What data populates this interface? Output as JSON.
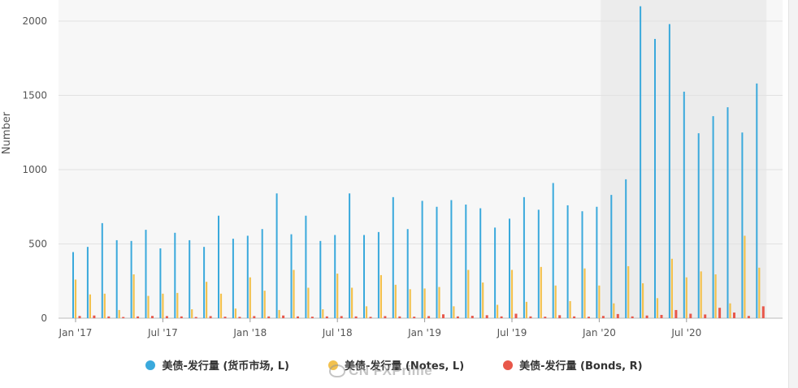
{
  "chart_data": {
    "type": "bar",
    "title": "",
    "xlabel": "",
    "ylabel": "Number",
    "ylim": [
      0,
      2000
    ],
    "y_ticks": [
      "0",
      "500",
      "1000",
      "1500",
      "2000"
    ],
    "x_tick_labels": [
      "Jan '17",
      "Jul '17",
      "Jan '18",
      "Jul '18",
      "Jan '19",
      "Jul '19",
      "Jan '20",
      "Jul '20"
    ],
    "x_tick_month_index": [
      0,
      6,
      12,
      18,
      24,
      30,
      36,
      42
    ],
    "grid": true,
    "legend_position": "bottom",
    "highlight_region": {
      "from_month_index": 37,
      "to_month_index": 47
    },
    "categories": [
      "2017-01",
      "2017-02",
      "2017-03",
      "2017-04",
      "2017-05",
      "2017-06",
      "2017-07",
      "2017-08",
      "2017-09",
      "2017-10",
      "2017-11",
      "2017-12",
      "2018-01",
      "2018-02",
      "2018-03",
      "2018-04",
      "2018-05",
      "2018-06",
      "2018-07",
      "2018-08",
      "2018-09",
      "2018-10",
      "2018-11",
      "2018-12",
      "2019-01",
      "2019-02",
      "2019-03",
      "2019-04",
      "2019-05",
      "2019-06",
      "2019-07",
      "2019-08",
      "2019-09",
      "2019-10",
      "2019-11",
      "2019-12",
      "2020-01",
      "2020-02",
      "2020-03",
      "2020-04",
      "2020-05",
      "2020-06",
      "2020-07",
      "2020-08",
      "2020-09",
      "2020-10",
      "2020-11",
      "2020-12"
    ],
    "series": [
      {
        "name": "美债-发行量 (货币市场, L)",
        "color": "#3aa9dc",
        "values": [
          445,
          480,
          640,
          525,
          520,
          595,
          470,
          575,
          525,
          480,
          690,
          535,
          555,
          600,
          840,
          565,
          690,
          520,
          560,
          840,
          560,
          580,
          815,
          600,
          790,
          750,
          795,
          765,
          740,
          610,
          670,
          815,
          730,
          910,
          760,
          720,
          750,
          830,
          935,
          2170,
          1880,
          1980,
          1525,
          1245,
          1360,
          1420,
          1250,
          1580
        ]
      },
      {
        "name": "美债-发行量 (Notes, L)",
        "color": "#f2c14e",
        "values": [
          260,
          160,
          165,
          55,
          295,
          150,
          165,
          170,
          60,
          245,
          165,
          65,
          275,
          185,
          55,
          325,
          205,
          60,
          300,
          205,
          80,
          290,
          225,
          195,
          200,
          210,
          80,
          325,
          240,
          90,
          325,
          110,
          345,
          220,
          115,
          335,
          220,
          100,
          350,
          235,
          135,
          400,
          275,
          315,
          295,
          100,
          555,
          340
        ]
      },
      {
        "name": "美债-发行量 (Bonds, R)",
        "color": "#e8574a",
        "values": [
          15,
          18,
          12,
          8,
          12,
          15,
          14,
          12,
          8,
          14,
          10,
          9,
          14,
          12,
          18,
          12,
          10,
          12,
          14,
          12,
          9,
          14,
          12,
          10,
          14,
          26,
          12,
          16,
          20,
          12,
          30,
          12,
          10,
          20,
          12,
          10,
          15,
          28,
          12,
          18,
          22,
          55,
          30,
          25,
          70,
          38,
          15,
          80
        ]
      }
    ]
  },
  "watermark": "CN FXPrime"
}
